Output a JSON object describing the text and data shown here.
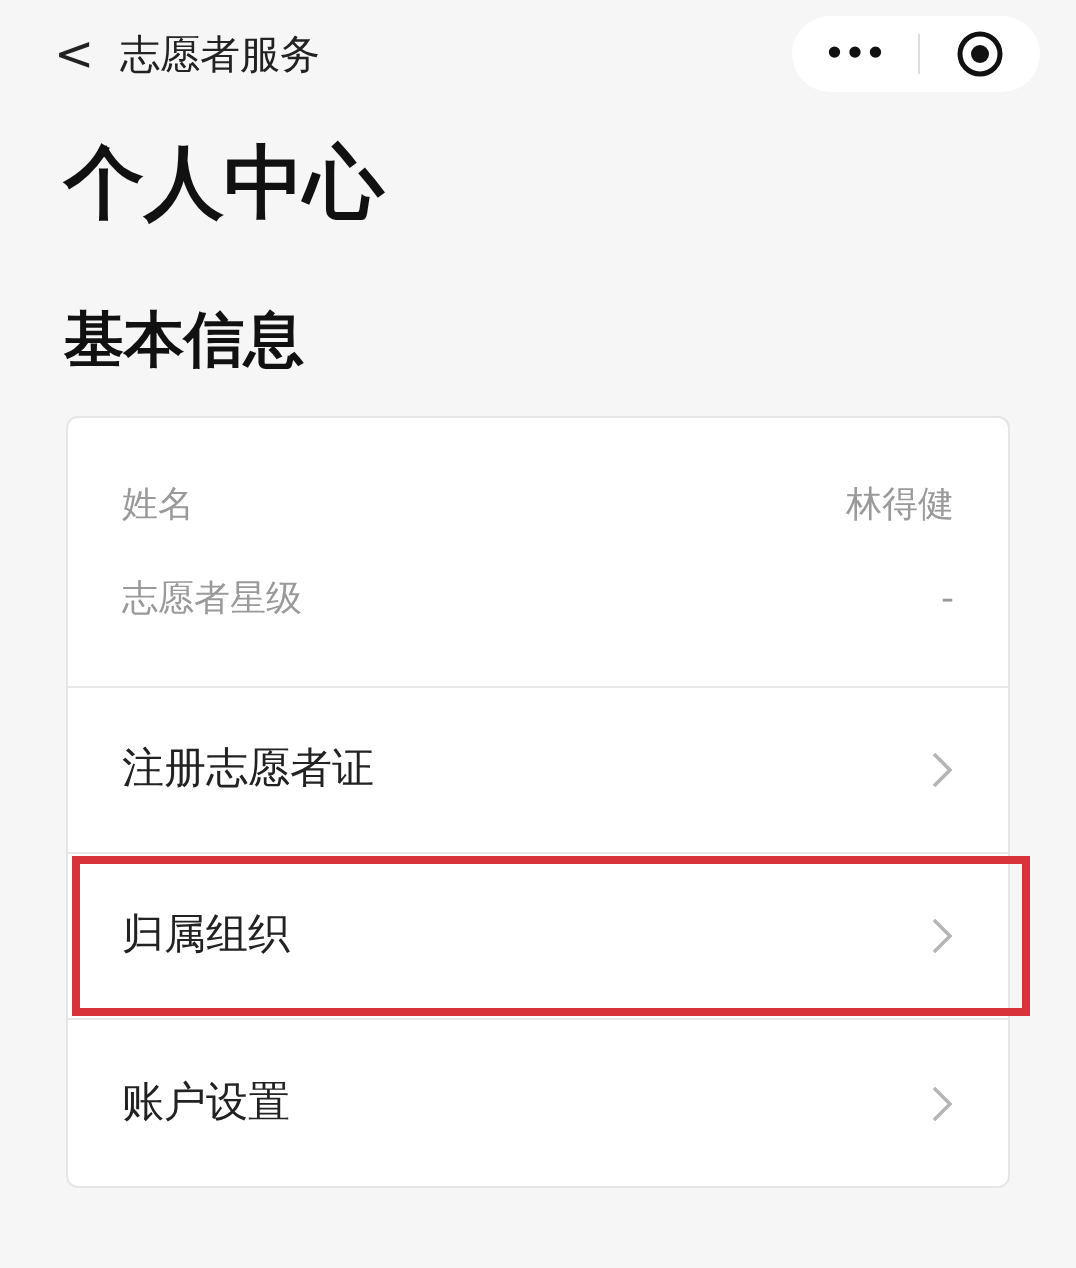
{
  "nav_bar": {
    "back": "<",
    "title": "志愿者服务",
    "more": "•••"
  },
  "page_title": "个人中心",
  "section_title": "基本信息",
  "info": [
    {
      "label": "姓名",
      "value": "林得健"
    },
    {
      "label": "志愿者星级",
      "value": "-"
    }
  ],
  "menu": [
    {
      "label": "注册志愿者证",
      "highlighted": false
    },
    {
      "label": "归属组织",
      "highlighted": true
    },
    {
      "label": "账户设置",
      "highlighted": false
    }
  ]
}
